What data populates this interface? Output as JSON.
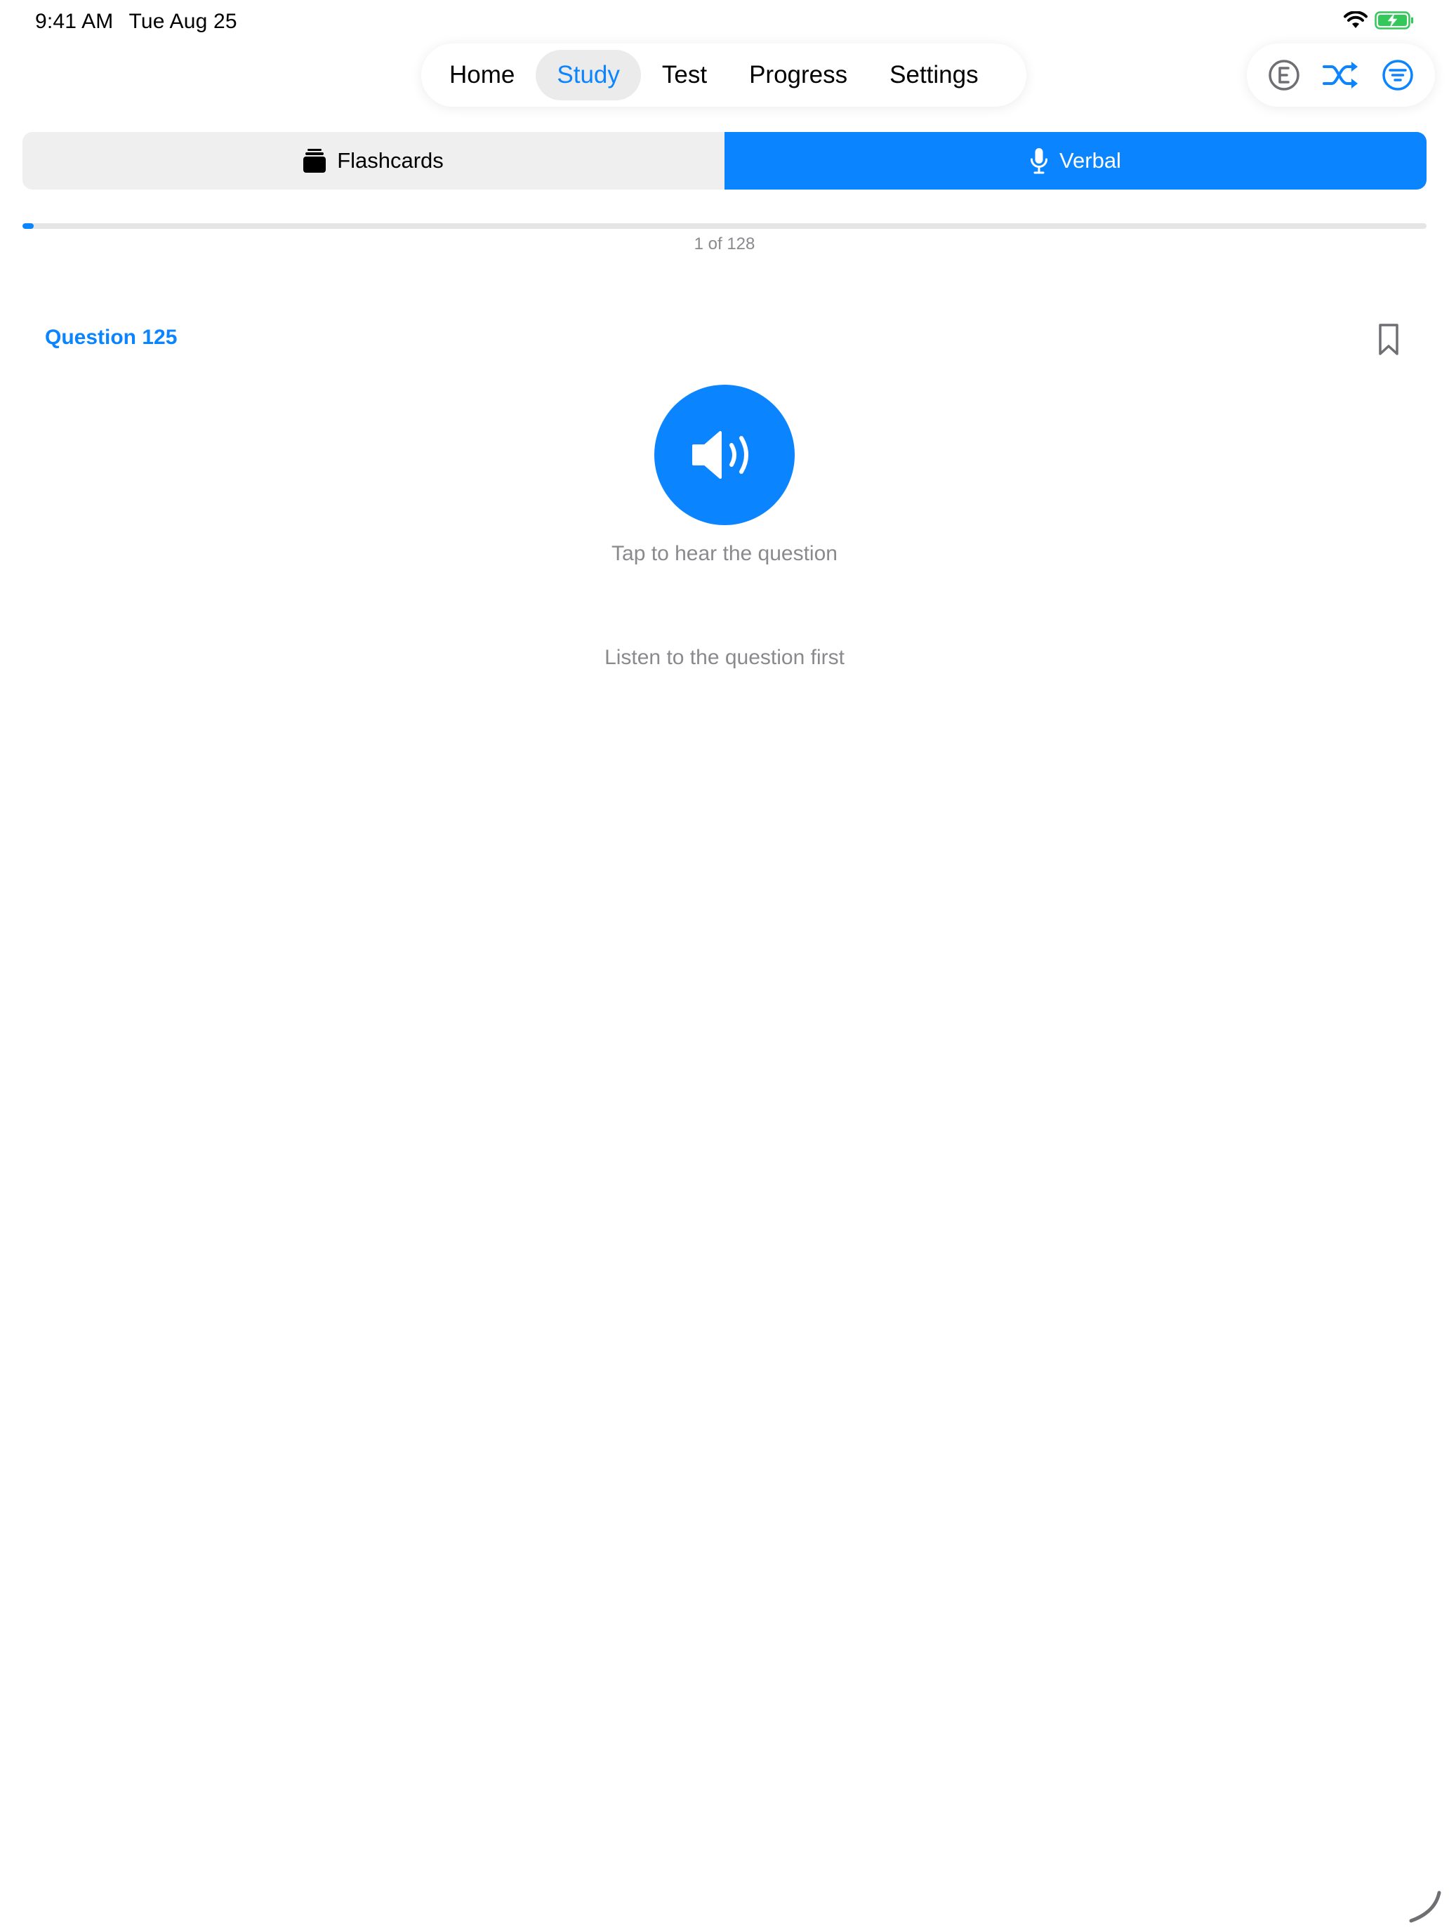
{
  "status_bar": {
    "time": "9:41 AM",
    "date": "Tue Aug 25"
  },
  "nav": {
    "items": [
      {
        "label": "Home",
        "active": false
      },
      {
        "label": "Study",
        "active": true
      },
      {
        "label": "Test",
        "active": false
      },
      {
        "label": "Progress",
        "active": false
      },
      {
        "label": "Settings",
        "active": false
      }
    ]
  },
  "toolbar_icons": [
    "e-circle-icon",
    "shuffle-icon",
    "filter-icon"
  ],
  "mode_selector": {
    "flashcards_label": "Flashcards",
    "verbal_label": "Verbal",
    "selected": "Verbal"
  },
  "progress": {
    "label": "1 of 128",
    "current": 1,
    "total": 128
  },
  "question": {
    "title": "Question 125"
  },
  "audio": {
    "tap_hint": "Tap to hear the question",
    "listen_hint": "Listen to the question first"
  },
  "colors": {
    "accent": "#0a84ff",
    "secondary_text": "#8a8a8e",
    "segment_bg": "#efefef",
    "battery_green": "#34c759"
  }
}
